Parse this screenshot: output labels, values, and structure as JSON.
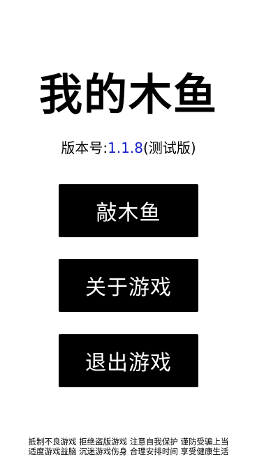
{
  "title": "我的木鱼",
  "version": {
    "label": "版本号:",
    "number": "1.1.8",
    "suffix": "(测试版)"
  },
  "buttons": {
    "knock": "敲木鱼",
    "about": "关于游戏",
    "exit": "退出游戏"
  },
  "notice": {
    "line1": "抵制不良游戏 拒绝盗版游戏 注意自我保护 谨防受骗上当",
    "line2": "适度游戏益脑 沉迷游戏伤身 合理安排时间 享受健康生活"
  },
  "colors": {
    "background": "#ffffff",
    "button_bg": "#000000",
    "button_text": "#ffffff",
    "version_number": "#1a23c8"
  }
}
